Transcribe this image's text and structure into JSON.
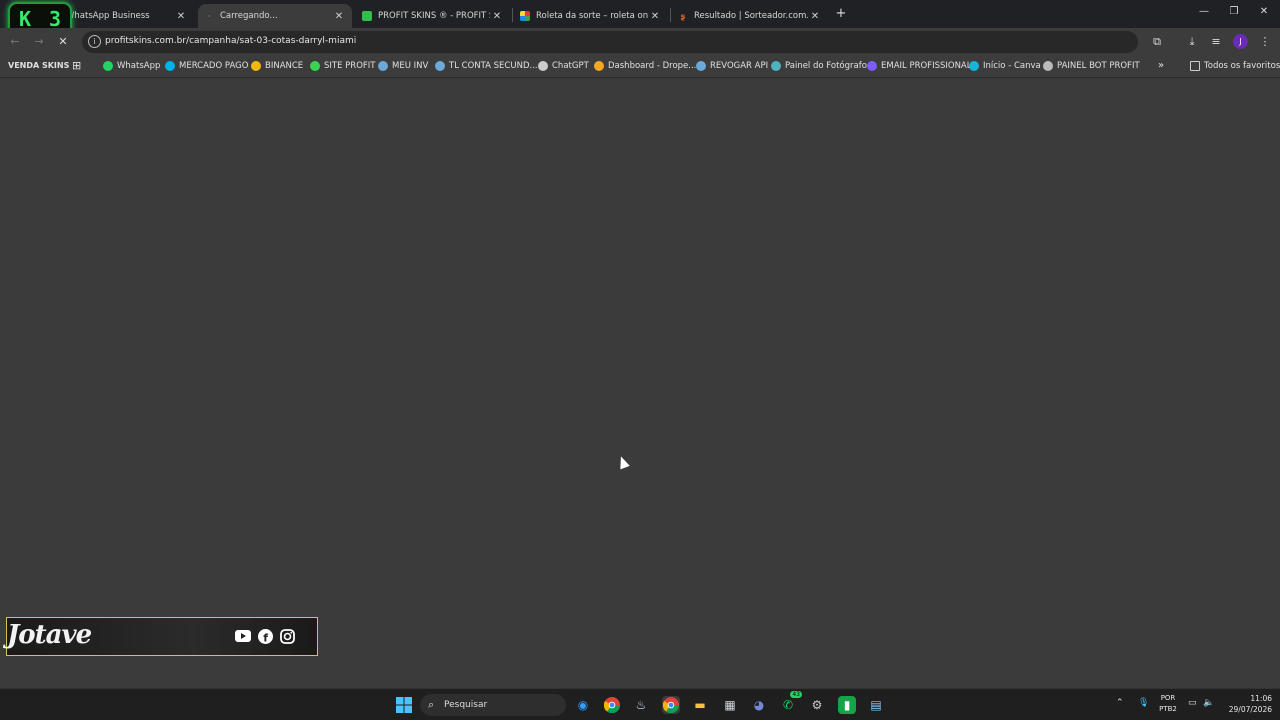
{
  "tabs": [
    {
      "title": "WhatsApp Business",
      "active": false
    },
    {
      "title": "Carregando...",
      "active": true
    },
    {
      "title": "PROFIT SKINS ® - PROFIT SKINS",
      "active": false
    },
    {
      "title": "Roleta da sorte – roleta online g",
      "active": false
    },
    {
      "title": "Resultado | Sorteador.com.br -",
      "active": false
    }
  ],
  "overlay_badge": {
    "left": "K",
    "right": "3"
  },
  "address_bar": {
    "url": "profitskins.com.br/campanha/sat-03-cotas-darryl-miami"
  },
  "bookmarks": {
    "first": "VENDA SKINS",
    "items": [
      {
        "label": "WhatsApp",
        "color": "#25d366"
      },
      {
        "label": "MERCADO PAGO",
        "color": "#00b1ea"
      },
      {
        "label": "BINANCE",
        "color": "#f0b90b"
      },
      {
        "label": "SITE PROFIT",
        "color": "#39d353"
      },
      {
        "label": "MEU INV",
        "color": "#6aa9d8"
      },
      {
        "label": "TL CONTA SECUND...",
        "color": "#6aa9d8"
      },
      {
        "label": "ChatGPT",
        "color": "#cccccc"
      },
      {
        "label": "Dashboard - Drope...",
        "color": "#f5a623"
      },
      {
        "label": "REVOGAR API",
        "color": "#6aa9d8"
      },
      {
        "label": "Painel do Fotógrafo",
        "color": "#4fb3bf"
      },
      {
        "label": "EMAIL PROFISSIONAL",
        "color": "#7b5cff"
      },
      {
        "label": "Início - Canva",
        "color": "#19b4d9"
      },
      {
        "label": "PAINEL BOT PROFIT",
        "color": "#bbbbbb"
      }
    ],
    "all_bookmarks": "Todos os favoritos"
  },
  "profile_initial": "J",
  "stream_overlay": {
    "name": "Jotave"
  },
  "taskbar": {
    "search_placeholder": "Pesquisar",
    "lang_line1": "POR",
    "lang_line2": "PTB2",
    "time": "11:06",
    "date": "29/07/2026",
    "whatsapp_badge": "43"
  }
}
